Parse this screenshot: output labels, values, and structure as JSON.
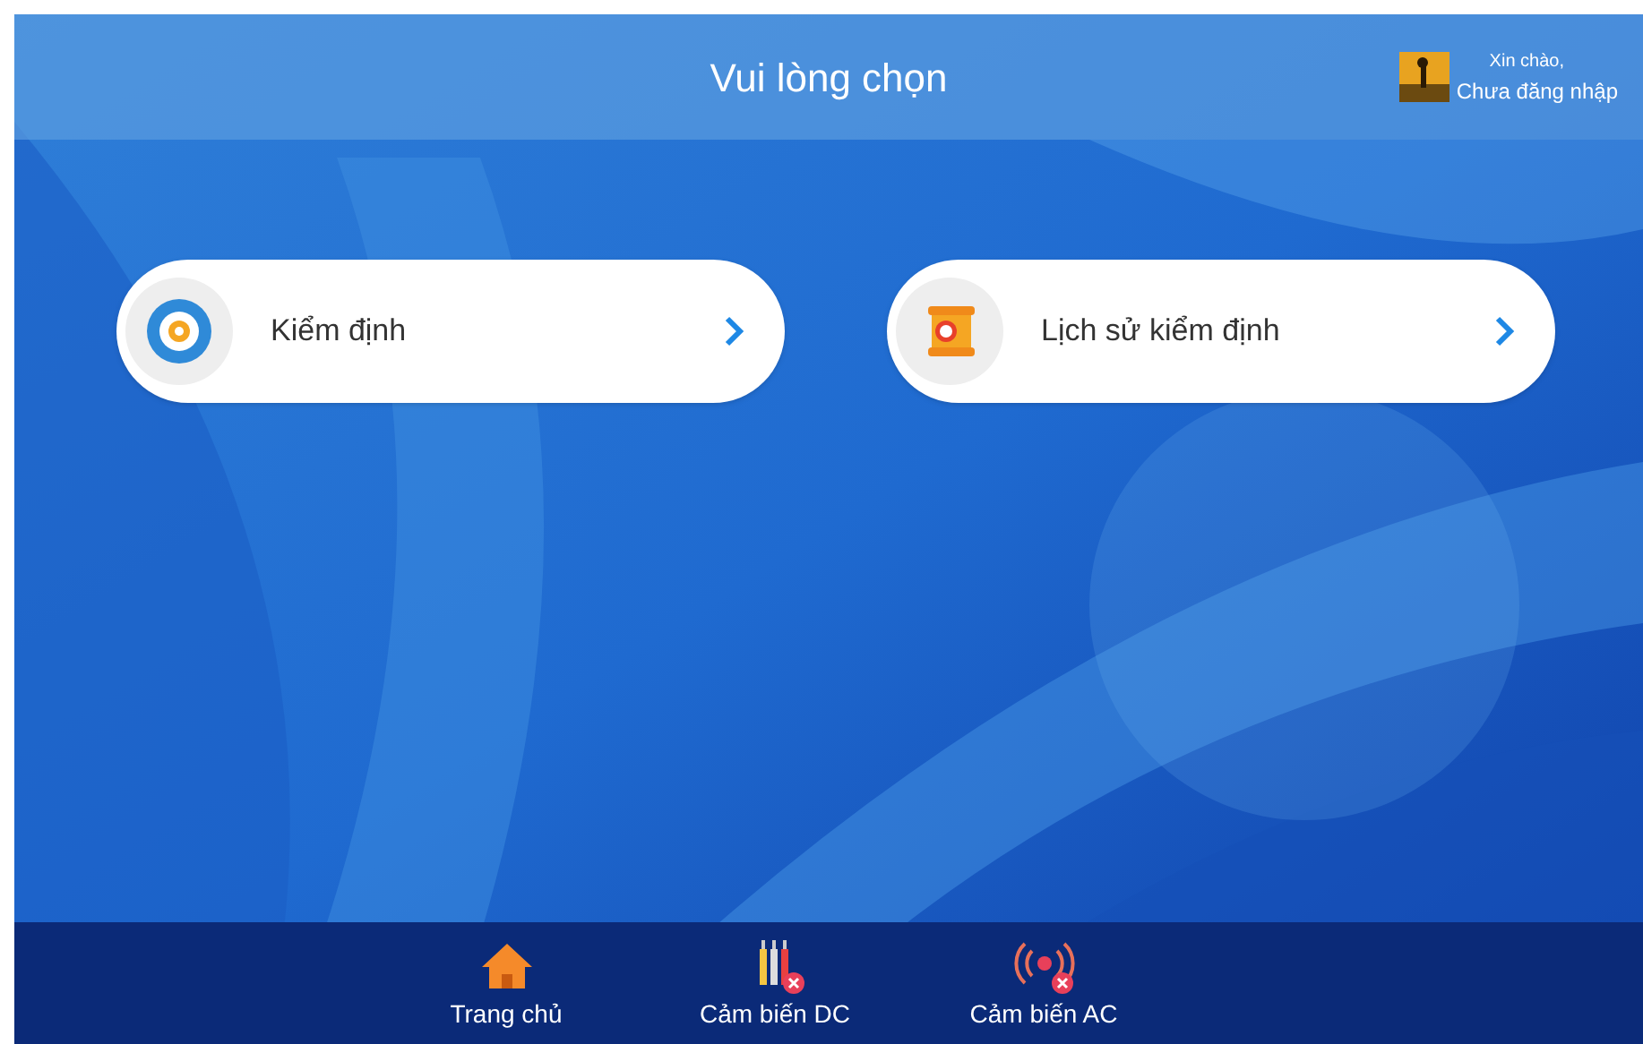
{
  "header": {
    "title": "Vui lòng chọn",
    "user": {
      "greeting": "Xin chào,",
      "status": "Chưa đăng nhập"
    }
  },
  "menu": [
    {
      "kind": "inspect",
      "label": "Kiểm định"
    },
    {
      "kind": "history",
      "label": "Lịch sử kiểm định"
    }
  ],
  "bottom_nav": [
    {
      "kind": "home",
      "label": "Trang chủ"
    },
    {
      "kind": "dc",
      "label": "Cảm biến DC",
      "connected": false
    },
    {
      "kind": "ac",
      "label": "Cảm biến AC",
      "connected": false
    }
  ]
}
